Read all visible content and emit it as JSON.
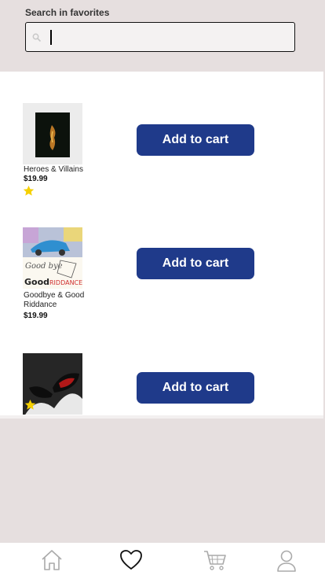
{
  "search": {
    "label": "Search in favorites",
    "value": "",
    "placeholder": ""
  },
  "items": [
    {
      "title": "Heroes & Villains",
      "price": "$19.99",
      "button": "Add to cart",
      "favorite": true
    },
    {
      "title": "Goodbye & Good Riddance",
      "price": "$19.99",
      "button": "Add to cart",
      "favorite": false
    },
    {
      "title": "",
      "price": "",
      "button": "Add to cart",
      "favorite": true
    }
  ],
  "nav": [
    "home-icon",
    "heart-icon",
    "cart-icon",
    "profile-icon"
  ],
  "colors": {
    "accent": "#1f3a8a",
    "star": "#f5d000",
    "background": "#e6dfdf"
  }
}
